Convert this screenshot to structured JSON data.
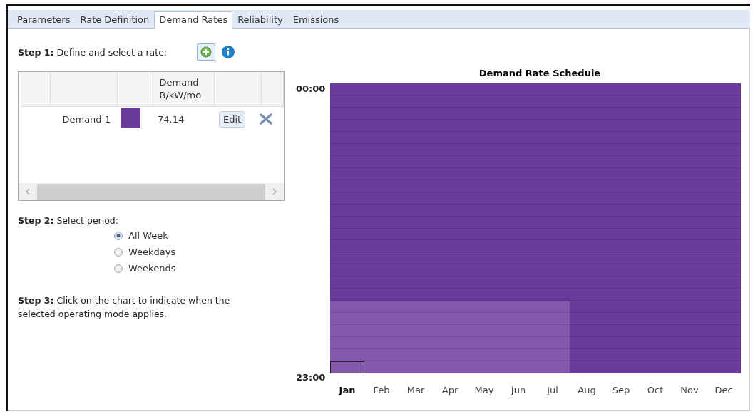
{
  "tabs": [
    {
      "label": "Parameters",
      "selected": false
    },
    {
      "label": "Rate Definition",
      "selected": false
    },
    {
      "label": "Demand Rates",
      "selected": true
    },
    {
      "label": "Reliability",
      "selected": false
    },
    {
      "label": "Emissions",
      "selected": false
    }
  ],
  "step1": {
    "label": "Step 1:",
    "text": "Define and select a rate:"
  },
  "rates_table": {
    "columns": [
      "Demand\nB/kW/mo"
    ],
    "rows": [
      {
        "name": "Demand 1",
        "color": "#6a3a9c",
        "value": "74.14",
        "edit": "Edit"
      }
    ]
  },
  "step2": {
    "label": "Step 2:",
    "text": "Select period:"
  },
  "periods": [
    {
      "label": "All Week",
      "selected": true
    },
    {
      "label": "Weekdays",
      "selected": false
    },
    {
      "label": "Weekends",
      "selected": false
    }
  ],
  "step3": {
    "label": "Step 3:",
    "text": "Click on the chart to indicate when the selected operating mode applies."
  },
  "schedule": {
    "title": "Demand Rate Schedule",
    "top_label": "00:00",
    "bottom_label": "23:00",
    "months": [
      {
        "label": "Jan",
        "selected": true,
        "highlighted": true
      },
      {
        "label": "Feb",
        "selected": false,
        "highlighted": true
      },
      {
        "label": "Mar",
        "selected": false,
        "highlighted": true
      },
      {
        "label": "Apr",
        "selected": false,
        "highlighted": true
      },
      {
        "label": "May",
        "selected": false,
        "highlighted": true
      },
      {
        "label": "Jun",
        "selected": false,
        "highlighted": true
      },
      {
        "label": "Jul",
        "selected": false,
        "highlighted": true
      },
      {
        "label": "Aug",
        "selected": false,
        "highlighted": false
      },
      {
        "label": "Sep",
        "selected": false,
        "highlighted": false
      },
      {
        "label": "Oct",
        "selected": false,
        "highlighted": false
      },
      {
        "label": "Nov",
        "selected": false,
        "highlighted": false
      },
      {
        "label": "Dec",
        "selected": false,
        "highlighted": false
      }
    ]
  }
}
